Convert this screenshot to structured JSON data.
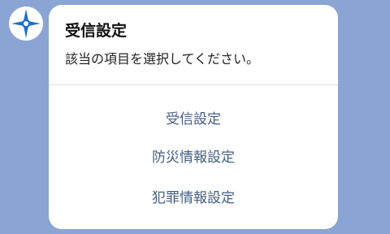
{
  "avatar": {
    "icon": "star-emblem-icon",
    "color": "#1e6fc9"
  },
  "dialog": {
    "title": "受信設定",
    "message": "該当の項目を選択してください。",
    "options": [
      {
        "label": "受信設定"
      },
      {
        "label": "防災情報設定"
      },
      {
        "label": "犯罪情報設定"
      }
    ]
  },
  "colors": {
    "background": "#8aa5d3",
    "card": "#ffffff",
    "option_text": "#445e86",
    "divider": "#e1e1e1"
  }
}
